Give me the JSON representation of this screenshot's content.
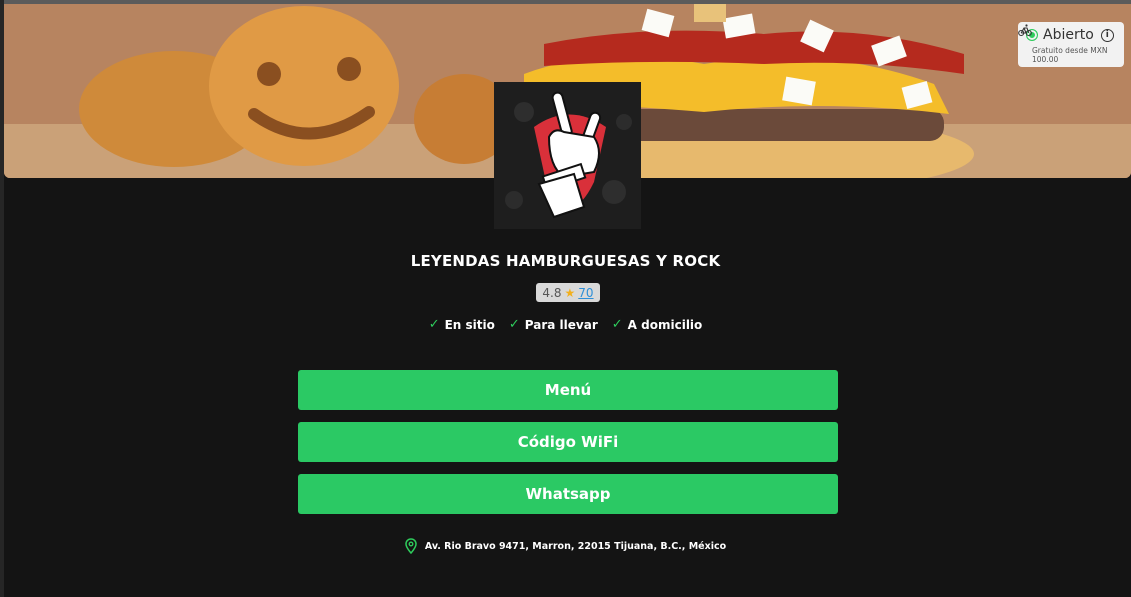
{
  "status": {
    "label": "Abierto",
    "delivery_note": "Gratuito desde MXN 100.00",
    "accent_color": "#2ecc5c"
  },
  "restaurant": {
    "name": "LEYENDAS HAMBURGUESAS Y ROCK",
    "rating": "4.8",
    "rating_count": "70"
  },
  "services": [
    {
      "label": "En sitio",
      "icon": "check-icon"
    },
    {
      "label": "Para llevar",
      "icon": "check-icon"
    },
    {
      "label": "A domicilio",
      "icon": "check-icon"
    }
  ],
  "buttons": {
    "menu": "Menú",
    "wifi": "Código WiFi",
    "whatsapp": "Whatsapp"
  },
  "address": "Av. Rio Bravo 9471, Marron, 22015 Tijuana, B.C., México",
  "theme": {
    "background": "#141414",
    "button_color": "#2bc964",
    "star_color": "#f2b01e",
    "link_color": "#2d8fd8"
  },
  "icons": {
    "status": "status-dot-icon",
    "info": "info-icon",
    "delivery": "bicycle-icon",
    "star": "star-icon",
    "address": "location-pin-icon"
  }
}
